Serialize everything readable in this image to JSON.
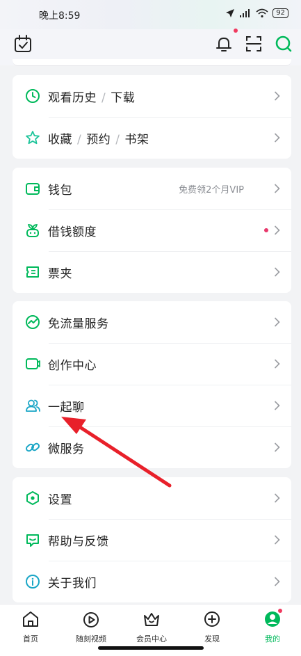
{
  "status": {
    "time": "晚上8:59",
    "battery": "92"
  },
  "colors": {
    "accent": "#00b95b",
    "arrow": "#e8202a",
    "badge": "#f03a5f"
  },
  "group1": [
    {
      "parts": [
        "观看历史",
        "下载"
      ],
      "icon": "clock-icon"
    },
    {
      "parts": [
        "收藏",
        "预约",
        "书架"
      ],
      "icon": "star-icon"
    }
  ],
  "group2": [
    {
      "label": "钱包",
      "aux": "免费领2个月VIP",
      "icon": "wallet-icon"
    },
    {
      "label": "借钱额度",
      "icon": "sprout-icon"
    },
    {
      "label": "票夹",
      "icon": "ticket-icon"
    }
  ],
  "group3": [
    {
      "label": "免流量服务",
      "icon": "traffic-icon"
    },
    {
      "label": "创作中心",
      "icon": "camera-icon"
    },
    {
      "label": "一起聊",
      "icon": "people-icon"
    },
    {
      "label": "微服务",
      "icon": "link-icon"
    }
  ],
  "group4": [
    {
      "label": "设置",
      "icon": "settings-icon"
    },
    {
      "label": "帮助与反馈",
      "icon": "feedback-icon"
    },
    {
      "label": "关于我们",
      "icon": "info-icon"
    }
  ],
  "tabs": [
    {
      "label": "首页",
      "icon": "home-icon"
    },
    {
      "label": "随刻视频",
      "icon": "play-icon"
    },
    {
      "label": "会员中心",
      "icon": "crown-icon"
    },
    {
      "label": "发现",
      "icon": "plus-icon"
    },
    {
      "label": "我的",
      "icon": "avatar-icon"
    }
  ]
}
